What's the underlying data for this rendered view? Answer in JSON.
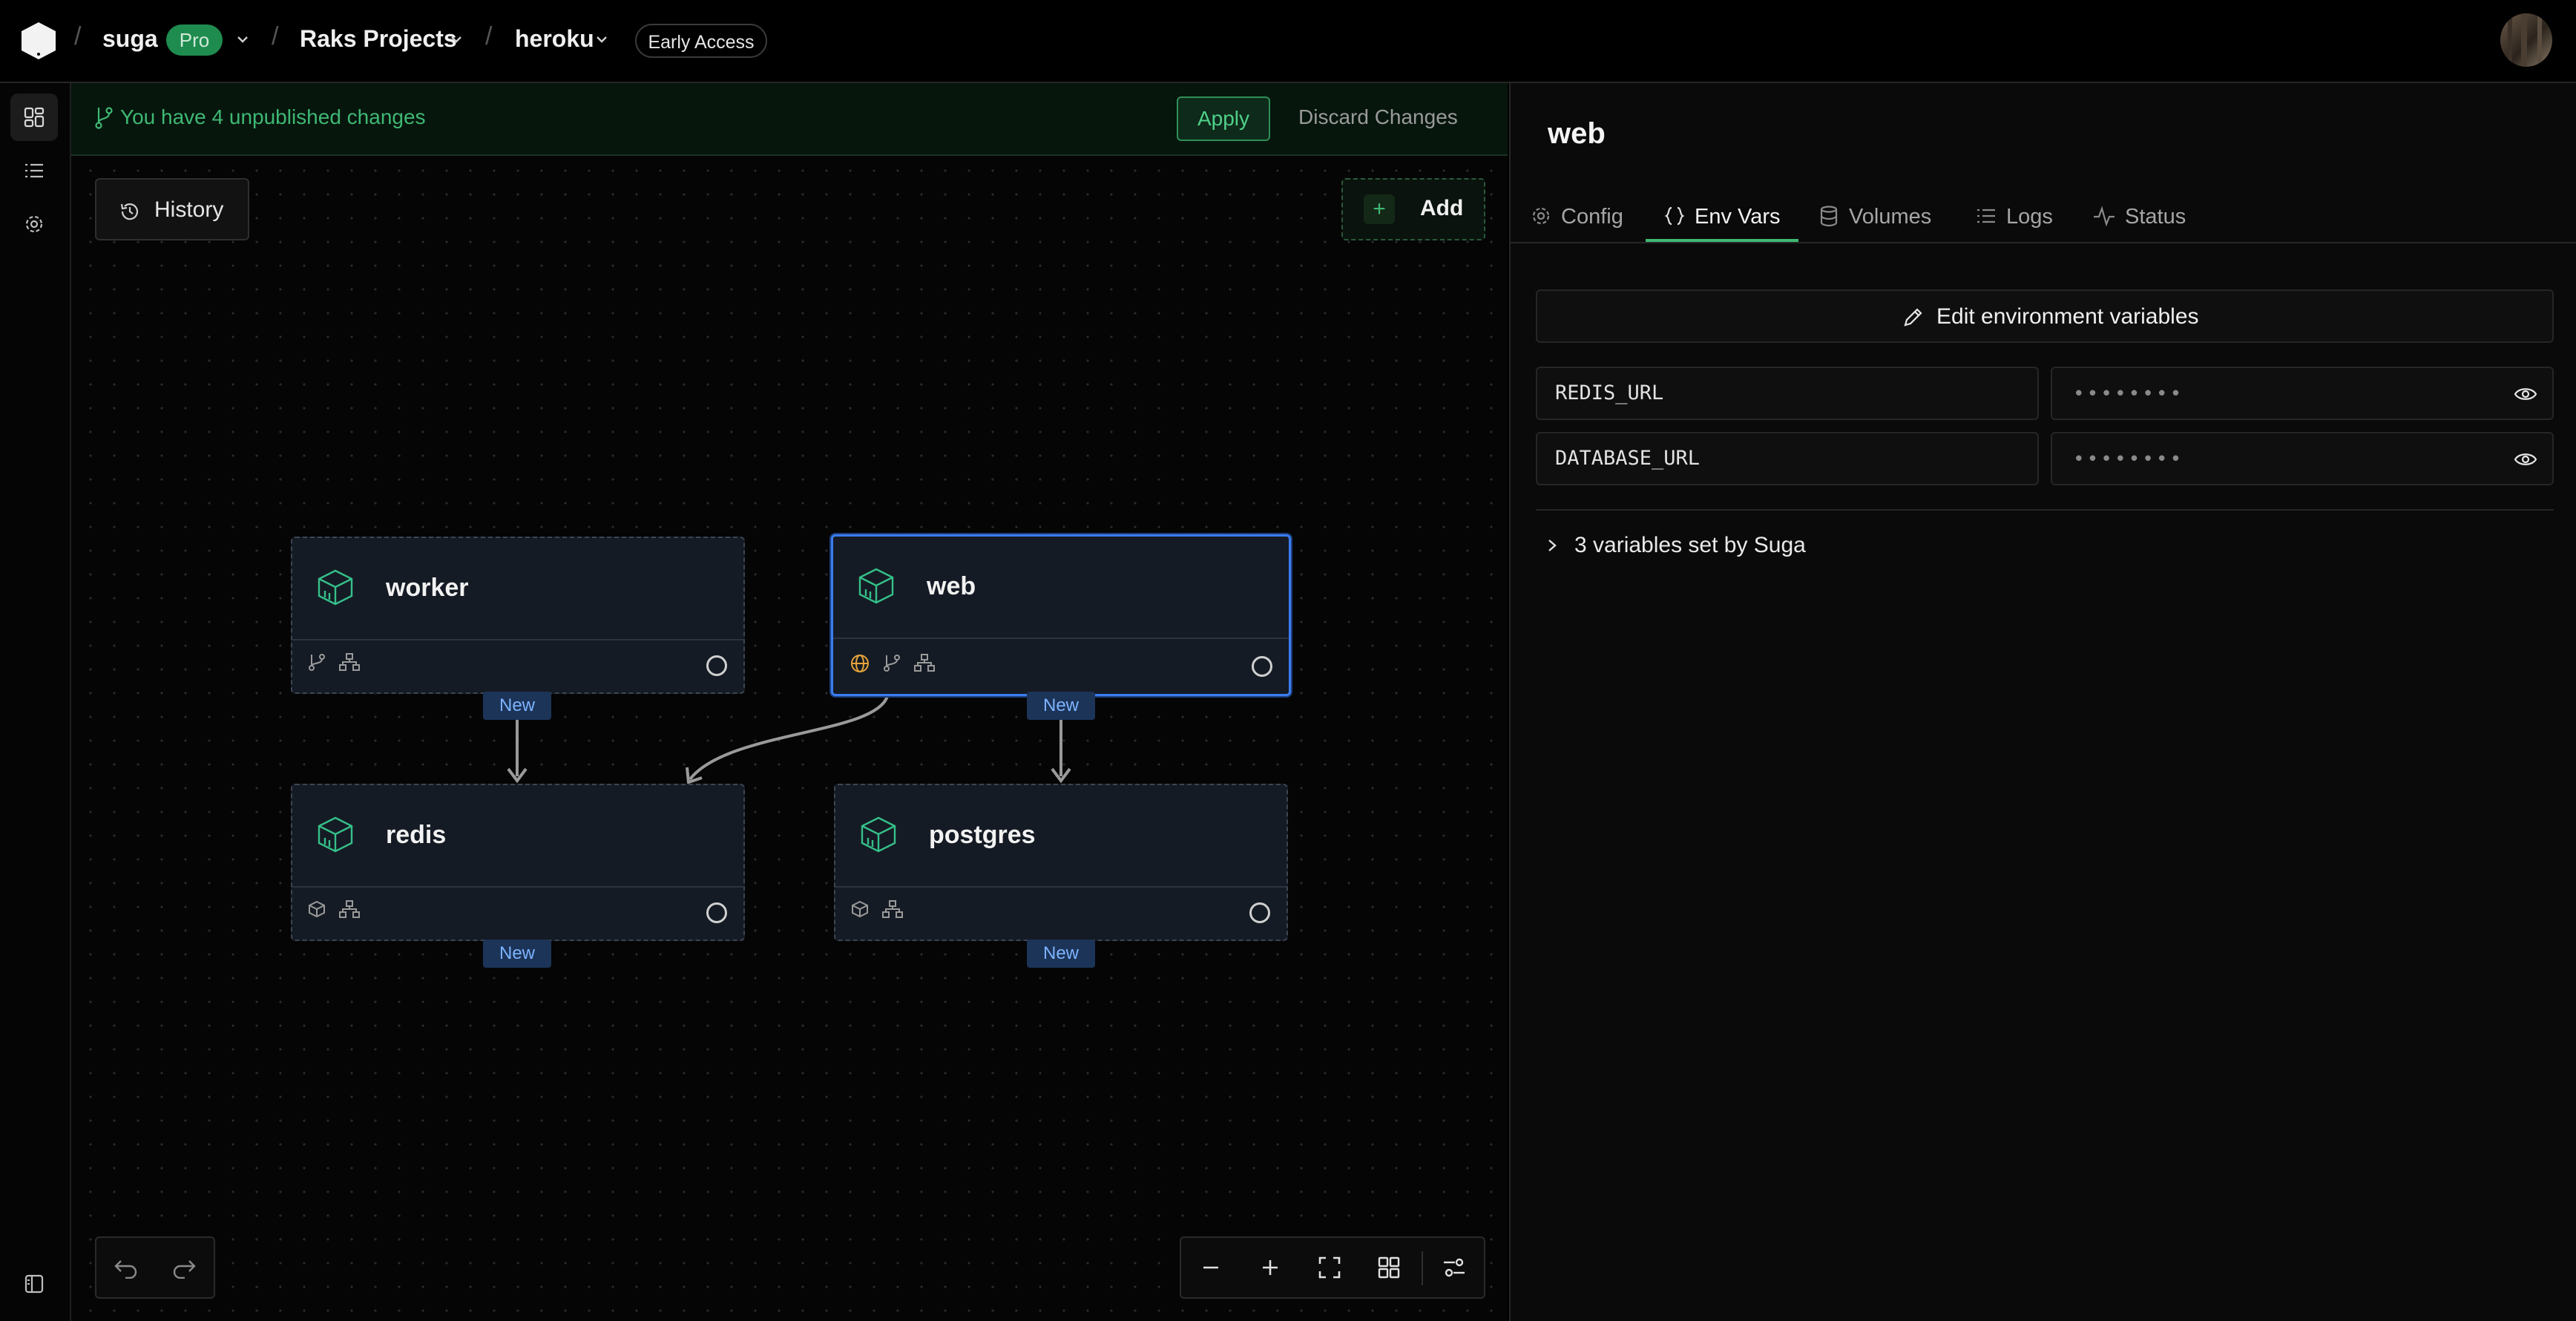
{
  "header": {
    "org": "suga",
    "plan_badge": "Pro",
    "project": "Raks Projects",
    "environment": "heroku",
    "early_access": "Early Access"
  },
  "changes_bar": {
    "message": "You have 4 unpublished changes",
    "apply": "Apply",
    "discard": "Discard Changes"
  },
  "canvas": {
    "history_label": "History",
    "add_label": "Add",
    "nodes": [
      {
        "name": "worker",
        "badge": "New"
      },
      {
        "name": "web",
        "badge": "New",
        "selected": true
      },
      {
        "name": "redis",
        "badge": "New"
      },
      {
        "name": "postgres",
        "badge": "New"
      }
    ]
  },
  "panel": {
    "title": "web",
    "tabs": [
      {
        "label": "Config",
        "icon": "gear-icon"
      },
      {
        "label": "Env Vars",
        "icon": "braces-icon",
        "active": true
      },
      {
        "label": "Volumes",
        "icon": "database-icon"
      },
      {
        "label": "Logs",
        "icon": "list-icon"
      },
      {
        "label": "Status",
        "icon": "activity-icon"
      }
    ],
    "edit_button": "Edit environment variables",
    "env_vars": [
      {
        "key": "REDIS_URL",
        "value": "••••••••"
      },
      {
        "key": "DATABASE_URL",
        "value": "••••••••"
      }
    ],
    "suga_vars": "3 variables set by Suga"
  },
  "colors": {
    "accent_green": "#3fb873",
    "selected_blue": "#3b7cf0",
    "new_badge": "#7db3ff",
    "globe_orange": "#e5a43a"
  }
}
